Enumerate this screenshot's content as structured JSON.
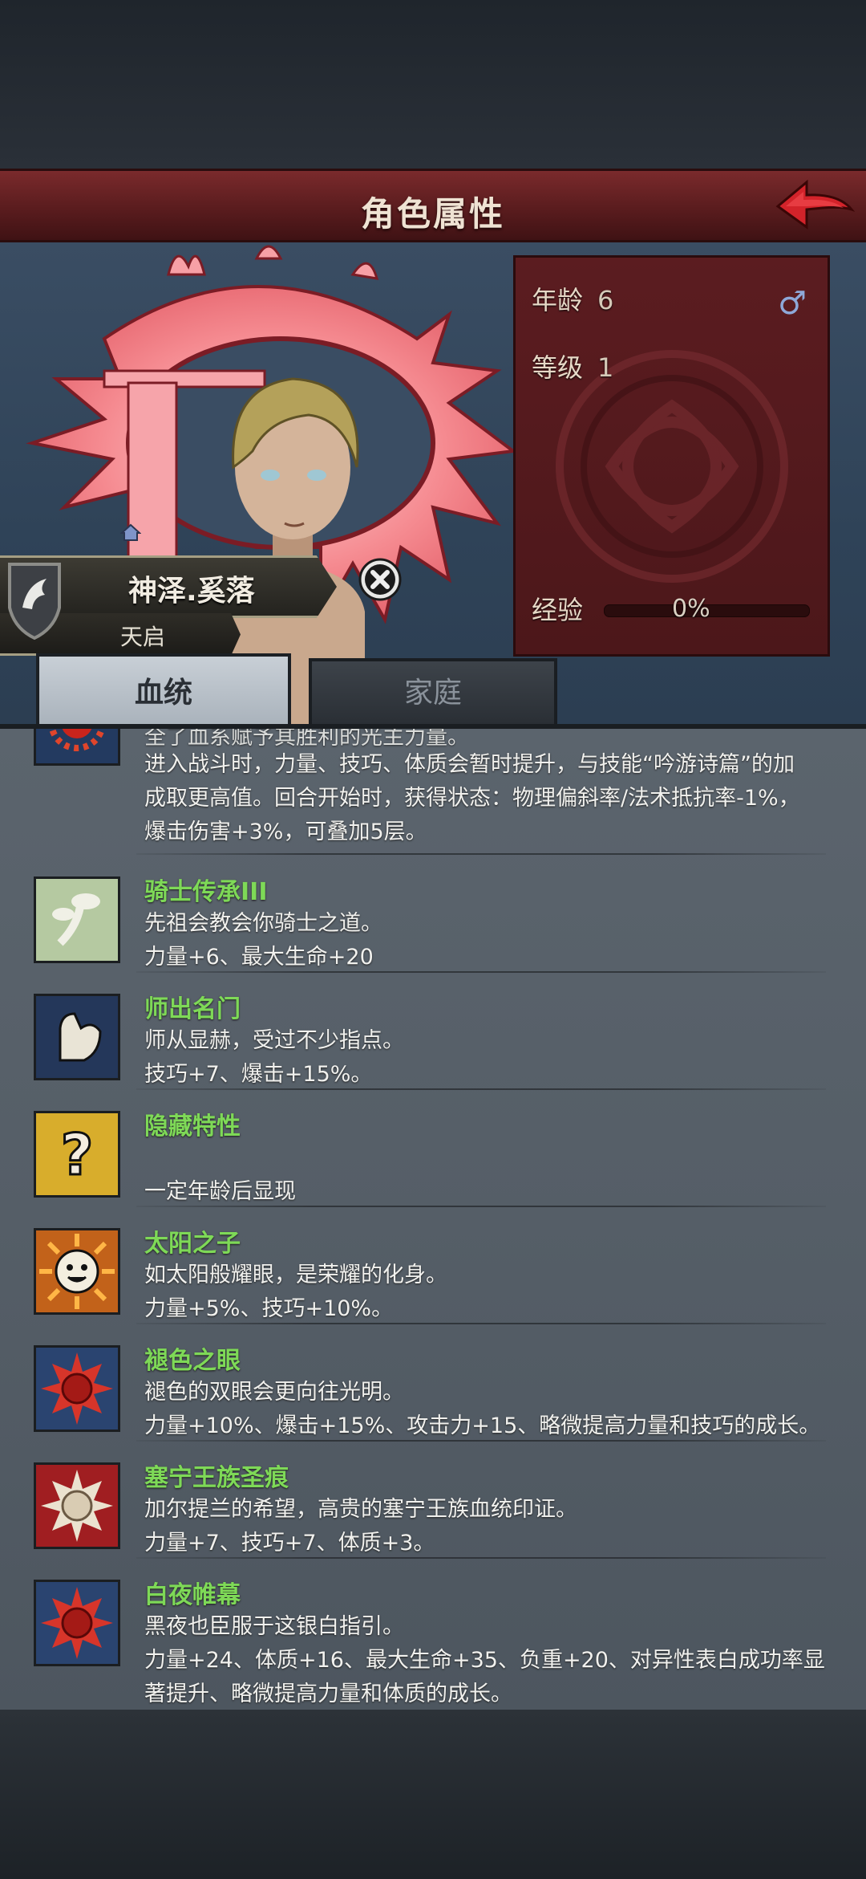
{
  "window": {
    "title": "角色属性"
  },
  "character": {
    "name": "神泽.奚落",
    "subtitle": "天启",
    "age_label": "年龄",
    "age_value": "6",
    "level_label": "等级",
    "level_value": "1",
    "exp_label": "经验",
    "exp_percent": "0%",
    "exp_fraction": 0,
    "gender_icon": "male-symbol-icon"
  },
  "tabs": [
    {
      "label": "血统",
      "active": true
    },
    {
      "label": "家庭",
      "active": false
    }
  ],
  "traits": {
    "partial": {
      "cut_line": "全了血系赋予其胜利的光主力量。",
      "line1": "进入战斗时，力量、技巧、体质会暂时提升，与技能“吟游诗篇”的加",
      "line2": "成取更高值。回合开始时，获得状态：物理偏斜率/法术抵抗率-1%，",
      "line3": "爆击伤害+3%，可叠加5层。",
      "icon": "red-sun-icon"
    },
    "items": [
      {
        "name": "骑士传承III",
        "desc": "先祖会教会你骑士之道。",
        "effect": "力量+6、最大生命+20",
        "icon": "sprout-icon"
      },
      {
        "name": "师出名门",
        "desc": "师从显赫，受过不少指点。",
        "effect": "技巧+7、爆击+15%。",
        "icon": "flexed-arm-icon"
      },
      {
        "name": "隐藏特性",
        "desc": "",
        "effect": "一定年龄后显现",
        "icon": "question-mark-icon"
      },
      {
        "name": "太阳之子",
        "desc": "如太阳般耀眼，是荣耀的化身。",
        "effect": "力量+5%、技巧+10%。",
        "icon": "smiling-sun-icon"
      },
      {
        "name": "褪色之眼",
        "desc": "褪色的双眼会更向往光明。",
        "effect": "力量+10%、爆击+15%、攻击力+15、略微提高力量和技巧的成长。",
        "icon": "red-sun-icon"
      },
      {
        "name": "塞宁王族圣痕",
        "desc": "加尔提兰的希望，高贵的塞宁王族血统印证。",
        "effect": "力量+7、技巧+7、体质+3。",
        "icon": "white-sun-icon"
      },
      {
        "name": "白夜帷幕",
        "desc": "黑夜也臣服于这银白指引。",
        "effect": "力量+24、体质+16、最大生命+35、负重+20、对异性表白成功率显",
        "effect2": "著提升、略微提高力量和体质的成长。",
        "icon": "red-sun-icon"
      }
    ]
  }
}
